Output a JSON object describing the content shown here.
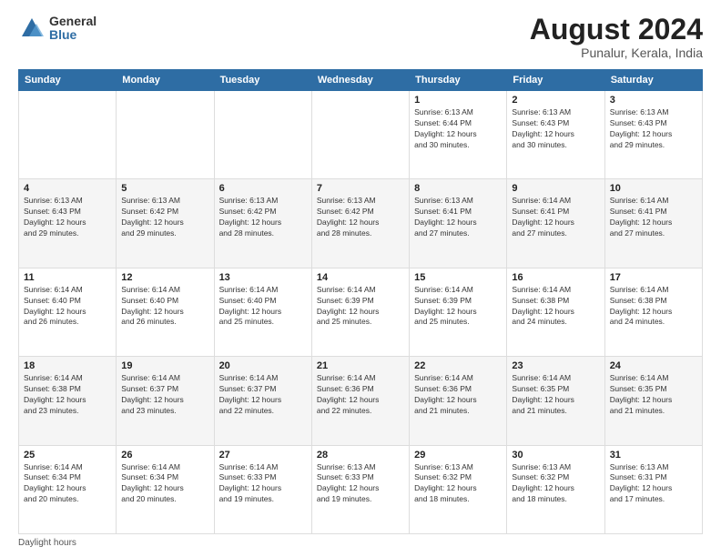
{
  "logo": {
    "general": "General",
    "blue": "Blue"
  },
  "title": "August 2024",
  "location": "Punalur, Kerala, India",
  "days_of_week": [
    "Sunday",
    "Monday",
    "Tuesday",
    "Wednesday",
    "Thursday",
    "Friday",
    "Saturday"
  ],
  "footer": "Daylight hours",
  "weeks": [
    [
      {
        "day": "",
        "info": ""
      },
      {
        "day": "",
        "info": ""
      },
      {
        "day": "",
        "info": ""
      },
      {
        "day": "",
        "info": ""
      },
      {
        "day": "1",
        "info": "Sunrise: 6:13 AM\nSunset: 6:44 PM\nDaylight: 12 hours\nand 30 minutes."
      },
      {
        "day": "2",
        "info": "Sunrise: 6:13 AM\nSunset: 6:43 PM\nDaylight: 12 hours\nand 30 minutes."
      },
      {
        "day": "3",
        "info": "Sunrise: 6:13 AM\nSunset: 6:43 PM\nDaylight: 12 hours\nand 29 minutes."
      }
    ],
    [
      {
        "day": "4",
        "info": "Sunrise: 6:13 AM\nSunset: 6:43 PM\nDaylight: 12 hours\nand 29 minutes."
      },
      {
        "day": "5",
        "info": "Sunrise: 6:13 AM\nSunset: 6:42 PM\nDaylight: 12 hours\nand 29 minutes."
      },
      {
        "day": "6",
        "info": "Sunrise: 6:13 AM\nSunset: 6:42 PM\nDaylight: 12 hours\nand 28 minutes."
      },
      {
        "day": "7",
        "info": "Sunrise: 6:13 AM\nSunset: 6:42 PM\nDaylight: 12 hours\nand 28 minutes."
      },
      {
        "day": "8",
        "info": "Sunrise: 6:13 AM\nSunset: 6:41 PM\nDaylight: 12 hours\nand 27 minutes."
      },
      {
        "day": "9",
        "info": "Sunrise: 6:14 AM\nSunset: 6:41 PM\nDaylight: 12 hours\nand 27 minutes."
      },
      {
        "day": "10",
        "info": "Sunrise: 6:14 AM\nSunset: 6:41 PM\nDaylight: 12 hours\nand 27 minutes."
      }
    ],
    [
      {
        "day": "11",
        "info": "Sunrise: 6:14 AM\nSunset: 6:40 PM\nDaylight: 12 hours\nand 26 minutes."
      },
      {
        "day": "12",
        "info": "Sunrise: 6:14 AM\nSunset: 6:40 PM\nDaylight: 12 hours\nand 26 minutes."
      },
      {
        "day": "13",
        "info": "Sunrise: 6:14 AM\nSunset: 6:40 PM\nDaylight: 12 hours\nand 25 minutes."
      },
      {
        "day": "14",
        "info": "Sunrise: 6:14 AM\nSunset: 6:39 PM\nDaylight: 12 hours\nand 25 minutes."
      },
      {
        "day": "15",
        "info": "Sunrise: 6:14 AM\nSunset: 6:39 PM\nDaylight: 12 hours\nand 25 minutes."
      },
      {
        "day": "16",
        "info": "Sunrise: 6:14 AM\nSunset: 6:38 PM\nDaylight: 12 hours\nand 24 minutes."
      },
      {
        "day": "17",
        "info": "Sunrise: 6:14 AM\nSunset: 6:38 PM\nDaylight: 12 hours\nand 24 minutes."
      }
    ],
    [
      {
        "day": "18",
        "info": "Sunrise: 6:14 AM\nSunset: 6:38 PM\nDaylight: 12 hours\nand 23 minutes."
      },
      {
        "day": "19",
        "info": "Sunrise: 6:14 AM\nSunset: 6:37 PM\nDaylight: 12 hours\nand 23 minutes."
      },
      {
        "day": "20",
        "info": "Sunrise: 6:14 AM\nSunset: 6:37 PM\nDaylight: 12 hours\nand 22 minutes."
      },
      {
        "day": "21",
        "info": "Sunrise: 6:14 AM\nSunset: 6:36 PM\nDaylight: 12 hours\nand 22 minutes."
      },
      {
        "day": "22",
        "info": "Sunrise: 6:14 AM\nSunset: 6:36 PM\nDaylight: 12 hours\nand 21 minutes."
      },
      {
        "day": "23",
        "info": "Sunrise: 6:14 AM\nSunset: 6:35 PM\nDaylight: 12 hours\nand 21 minutes."
      },
      {
        "day": "24",
        "info": "Sunrise: 6:14 AM\nSunset: 6:35 PM\nDaylight: 12 hours\nand 21 minutes."
      }
    ],
    [
      {
        "day": "25",
        "info": "Sunrise: 6:14 AM\nSunset: 6:34 PM\nDaylight: 12 hours\nand 20 minutes."
      },
      {
        "day": "26",
        "info": "Sunrise: 6:14 AM\nSunset: 6:34 PM\nDaylight: 12 hours\nand 20 minutes."
      },
      {
        "day": "27",
        "info": "Sunrise: 6:14 AM\nSunset: 6:33 PM\nDaylight: 12 hours\nand 19 minutes."
      },
      {
        "day": "28",
        "info": "Sunrise: 6:13 AM\nSunset: 6:33 PM\nDaylight: 12 hours\nand 19 minutes."
      },
      {
        "day": "29",
        "info": "Sunrise: 6:13 AM\nSunset: 6:32 PM\nDaylight: 12 hours\nand 18 minutes."
      },
      {
        "day": "30",
        "info": "Sunrise: 6:13 AM\nSunset: 6:32 PM\nDaylight: 12 hours\nand 18 minutes."
      },
      {
        "day": "31",
        "info": "Sunrise: 6:13 AM\nSunset: 6:31 PM\nDaylight: 12 hours\nand 17 minutes."
      }
    ]
  ]
}
